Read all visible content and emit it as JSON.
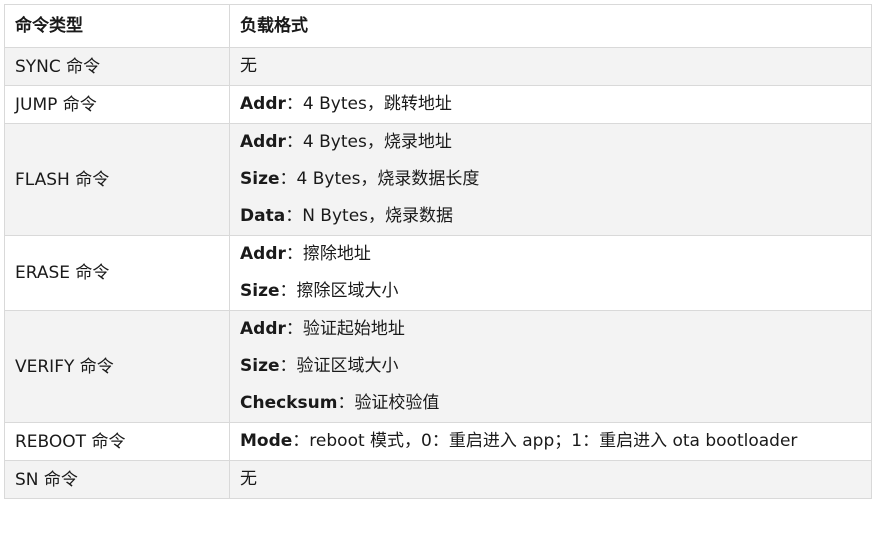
{
  "header": {
    "col_cmd": "命令类型",
    "col_payload": "负载格式"
  },
  "rows": [
    {
      "cmd": "SYNC 命令",
      "lines": [
        {
          "key": "",
          "sep": "",
          "val": "无"
        }
      ]
    },
    {
      "cmd": "JUMP 命令",
      "lines": [
        {
          "key": "Addr",
          "sep": "：",
          "val": "4 Bytes，跳转地址"
        }
      ]
    },
    {
      "cmd": "FLASH 命令",
      "lines": [
        {
          "key": "Addr",
          "sep": "：",
          "val": "4 Bytes，烧录地址"
        },
        {
          "key": "Size",
          "sep": "：",
          "val": "4 Bytes，烧录数据长度"
        },
        {
          "key": "Data",
          "sep": "：",
          "val": "N Bytes，烧录数据"
        }
      ]
    },
    {
      "cmd": "ERASE 命令",
      "lines": [
        {
          "key": "Addr",
          "sep": "：",
          "val": "擦除地址"
        },
        {
          "key": "Size",
          "sep": "：",
          "val": "擦除区域大小"
        }
      ]
    },
    {
      "cmd": "VERIFY 命令",
      "lines": [
        {
          "key": "Addr",
          "sep": "：",
          "val": "验证起始地址"
        },
        {
          "key": "Size",
          "sep": "：",
          "val": "验证区域大小"
        },
        {
          "key": "Checksum",
          "sep": "：",
          "val": "验证校验值"
        }
      ]
    },
    {
      "cmd": "REBOOT 命令",
      "lines": [
        {
          "key": "Mode",
          "sep": "：",
          "val": "reboot 模式，0：重启进入 app；1：重启进入 ota bootloader"
        }
      ]
    },
    {
      "cmd": "SN 命令",
      "lines": [
        {
          "key": "",
          "sep": "",
          "val": "无"
        }
      ]
    }
  ]
}
